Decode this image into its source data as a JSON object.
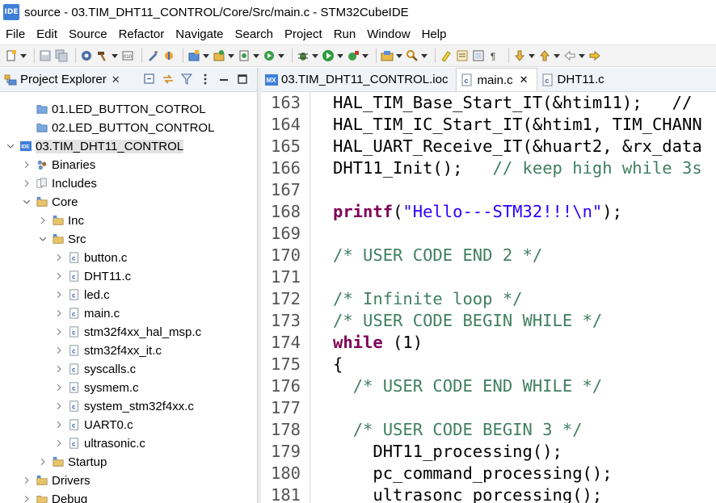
{
  "window": {
    "title": "source - 03.TIM_DHT11_CONTROL/Core/Src/main.c - STM32CubeIDE",
    "app_badge": "IDE"
  },
  "menubar": [
    "File",
    "Edit",
    "Source",
    "Refactor",
    "Navigate",
    "Search",
    "Project",
    "Run",
    "Window",
    "Help"
  ],
  "toolbar": {
    "icons": [
      "new-file-icon",
      "save-icon",
      "save-all-icon",
      "settings-icon",
      "build-hammer-icon",
      "binary-icon",
      "debug-config-icon",
      "wrench-icon",
      "new-project-icon",
      "open-type-icon",
      "new-class-icon",
      "run-history-icon",
      "debug-bug-icon",
      "run-icon",
      "external-tools-icon",
      "open-perspective-icon",
      "search-icon",
      "highlighter-icon",
      "toggle-mark-icon",
      "toggle-block-icon",
      "pilcrow-icon",
      "next-annotation-icon",
      "previous-annotation-icon",
      "back-icon",
      "forward-icon"
    ]
  },
  "explorer": {
    "title": "Project Explorer",
    "items": [
      {
        "label": "01.LED_BUTTON_COTROL",
        "depth": 1,
        "icon": "project-folder-icon",
        "twisty": "none"
      },
      {
        "label": "02.LED_BUTTON_CONTROL",
        "depth": 1,
        "icon": "project-folder-icon",
        "twisty": "none"
      },
      {
        "label": "03.TIM_DHT11_CONTROL",
        "depth": 0,
        "icon": "ide-project-icon",
        "twisty": "open",
        "selected": true
      },
      {
        "label": "Binaries",
        "depth": 1,
        "icon": "binaries-icon",
        "twisty": "closed"
      },
      {
        "label": "Includes",
        "depth": 1,
        "icon": "includes-icon",
        "twisty": "closed"
      },
      {
        "label": "Core",
        "depth": 1,
        "icon": "source-folder-icon",
        "twisty": "open"
      },
      {
        "label": "Inc",
        "depth": 2,
        "icon": "source-folder-icon",
        "twisty": "closed"
      },
      {
        "label": "Src",
        "depth": 2,
        "icon": "source-folder-icon",
        "twisty": "open"
      },
      {
        "label": "button.c",
        "depth": 3,
        "icon": "c-file-icon",
        "twisty": "closed"
      },
      {
        "label": "DHT11.c",
        "depth": 3,
        "icon": "c-file-icon",
        "twisty": "closed"
      },
      {
        "label": "led.c",
        "depth": 3,
        "icon": "c-file-icon",
        "twisty": "closed"
      },
      {
        "label": "main.c",
        "depth": 3,
        "icon": "c-file-icon",
        "twisty": "closed"
      },
      {
        "label": "stm32f4xx_hal_msp.c",
        "depth": 3,
        "icon": "c-file-icon",
        "twisty": "closed"
      },
      {
        "label": "stm32f4xx_it.c",
        "depth": 3,
        "icon": "c-file-icon",
        "twisty": "closed"
      },
      {
        "label": "syscalls.c",
        "depth": 3,
        "icon": "c-file-icon",
        "twisty": "closed"
      },
      {
        "label": "sysmem.c",
        "depth": 3,
        "icon": "c-file-icon",
        "twisty": "closed"
      },
      {
        "label": "system_stm32f4xx.c",
        "depth": 3,
        "icon": "c-file-icon",
        "twisty": "closed"
      },
      {
        "label": "UART0.c",
        "depth": 3,
        "icon": "c-file-icon",
        "twisty": "closed"
      },
      {
        "label": "ultrasonic.c",
        "depth": 3,
        "icon": "c-file-icon",
        "twisty": "closed"
      },
      {
        "label": "Startup",
        "depth": 2,
        "icon": "source-folder-icon",
        "twisty": "closed"
      },
      {
        "label": "Drivers",
        "depth": 1,
        "icon": "source-folder-icon",
        "twisty": "closed"
      },
      {
        "label": "Debug",
        "depth": 1,
        "icon": "folder-icon",
        "twisty": "closed"
      }
    ]
  },
  "editor": {
    "tabs": [
      {
        "label": "03.TIM_DHT11_CONTROL.ioc",
        "icon": "mx-ioc-icon",
        "active": false,
        "closable": false
      },
      {
        "label": "main.c",
        "icon": "c-file-icon",
        "active": true,
        "closable": true
      },
      {
        "label": "DHT11.c",
        "icon": "c-file-icon",
        "active": false,
        "closable": false
      }
    ],
    "lines": [
      {
        "n": "163",
        "indent": "",
        "parts": [
          {
            "t": "HAL_TIM_Base_Start_IT(&htim11);   //",
            "c": ""
          }
        ]
      },
      {
        "n": "164",
        "indent": "",
        "parts": [
          {
            "t": "HAL_TIM_IC_Start_IT(&htim1, TIM_CHANN",
            "c": ""
          }
        ]
      },
      {
        "n": "165",
        "indent": "",
        "parts": [
          {
            "t": "HAL_UART_Receive_IT(&huart2, &rx_data",
            "c": ""
          }
        ]
      },
      {
        "n": "166",
        "indent": "",
        "parts": [
          {
            "t": "DHT11_Init();   ",
            "c": ""
          },
          {
            "t": "// keep high while 3s",
            "c": "cmt"
          }
        ]
      },
      {
        "n": "167",
        "indent": "",
        "parts": []
      },
      {
        "n": "168",
        "indent": "",
        "parts": [
          {
            "t": "printf",
            "c": "kw"
          },
          {
            "t": "(",
            "c": ""
          },
          {
            "t": "\"Hello---STM32!!!\\n\"",
            "c": "str"
          },
          {
            "t": ");",
            "c": ""
          }
        ]
      },
      {
        "n": "169",
        "indent": "",
        "parts": []
      },
      {
        "n": "170",
        "indent": "",
        "parts": [
          {
            "t": "/* USER CODE END 2 */",
            "c": "cmt"
          }
        ]
      },
      {
        "n": "171",
        "indent": "",
        "parts": []
      },
      {
        "n": "172",
        "indent": "",
        "parts": [
          {
            "t": "/* Infinite loop */",
            "c": "cmt"
          }
        ]
      },
      {
        "n": "173",
        "indent": "",
        "parts": [
          {
            "t": "/* USER CODE BEGIN WHILE */",
            "c": "cmt"
          }
        ]
      },
      {
        "n": "174",
        "indent": "",
        "parts": [
          {
            "t": "while",
            "c": "kw"
          },
          {
            "t": " (1)",
            "c": ""
          }
        ]
      },
      {
        "n": "175",
        "indent": "",
        "parts": [
          {
            "t": "{",
            "c": ""
          }
        ]
      },
      {
        "n": "176",
        "indent": "  ",
        "parts": [
          {
            "t": "/* USER CODE END WHILE */",
            "c": "cmt"
          }
        ]
      },
      {
        "n": "177",
        "indent": "",
        "parts": []
      },
      {
        "n": "178",
        "indent": "  ",
        "parts": [
          {
            "t": "/* USER CODE BEGIN 3 */",
            "c": "cmt"
          }
        ]
      },
      {
        "n": "179",
        "indent": "    ",
        "parts": [
          {
            "t": "DHT11_processing();",
            "c": ""
          }
        ]
      },
      {
        "n": "180",
        "indent": "    ",
        "parts": [
          {
            "t": "pc_command_processing();",
            "c": ""
          }
        ]
      },
      {
        "n": "181",
        "indent": "    ",
        "parts": [
          {
            "t": "ultrasonc_porcessing();",
            "c": ""
          }
        ]
      }
    ]
  },
  "colors": {
    "keyword": "#7f0055",
    "string": "#2a00ff",
    "comment": "#3f7f5f",
    "selection": "#e3e3e3"
  }
}
